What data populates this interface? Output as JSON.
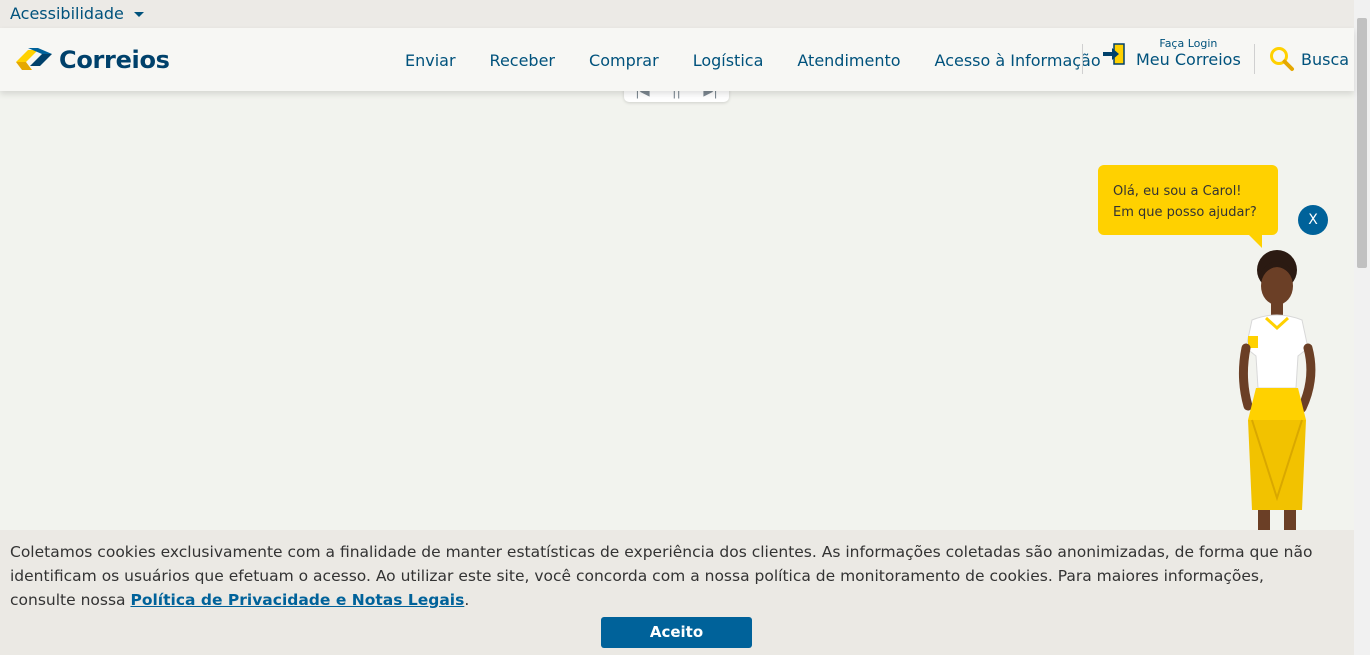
{
  "accessibility": {
    "label": "Acessibilidade"
  },
  "header": {
    "logo_text": "Correios",
    "nav": [
      "Enviar",
      "Receber",
      "Comprar",
      "Logística",
      "Atendimento",
      "Acesso à Informação"
    ],
    "login": {
      "small": "Faça Login",
      "big": "Meu Correios"
    },
    "search_label": "Busca"
  },
  "carousel_controls": {
    "prev": "|◀",
    "pause": "||",
    "next": "▶|"
  },
  "assistant": {
    "bubble_text": "Olá, eu sou a Carol! Em que posso ajudar?",
    "close_label": "X"
  },
  "cookie_banner": {
    "text": "Coletamos cookies exclusivamente com a finalidade de manter estatísticas de experiência dos clientes. As informações coletadas são anonimizadas, de forma que não identificam os usuários que efetuam o acesso. Ao utilizar este site, você concorda com a nossa política de monitoramento de cookies. Para maiores informações, consulte nossa ",
    "link_text": "Política de Privacidade e Notas Legais",
    "after_link": ".",
    "accept_label": "Aceito"
  },
  "colors": {
    "brand_blue": "#00416b",
    "link_blue": "#00527c",
    "accent_yellow": "#ffd100",
    "button_blue": "#00629a"
  }
}
